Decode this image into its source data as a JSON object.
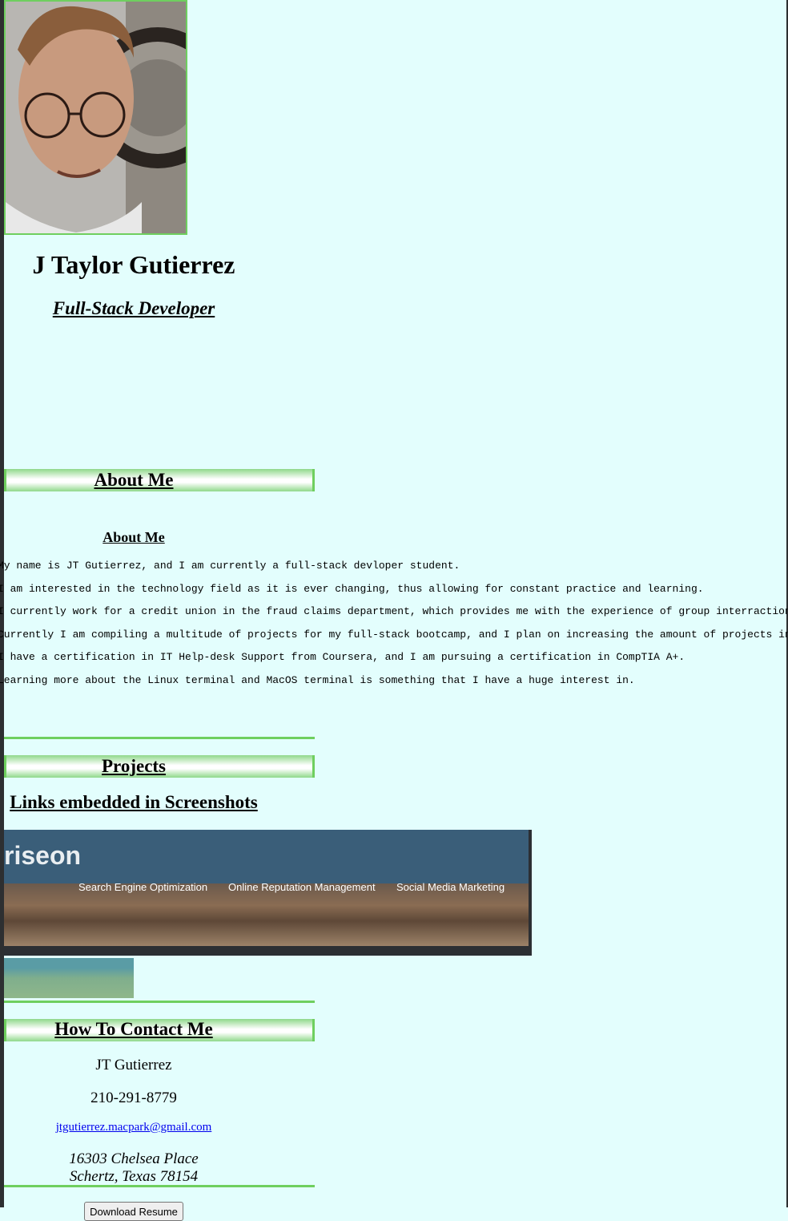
{
  "header": {
    "name": "J Taylor Gutierrez",
    "role": "Full-Stack Developer",
    "photo_icon": "profile-photo"
  },
  "about": {
    "section_title": "About Me",
    "sub_title": "About Me",
    "paragraphs": [
      "My name is JT Gutierrez, and I am currently a full-stack devloper student.",
      "I am interested in the technology field as it is ever changing, thus allowing for constant practice and learning.",
      "I currently work for a credit union in the fraud claims department, which provides me with the experience of group interraction and",
      "Currently I am compiling a multitude of projects for my full-stack bootcamp, and I plan on increasing the amount of projects in my p",
      "I have a certification in IT Help-desk Support from Coursera, and I am pursuing a certification in CompTIA A+.",
      "Learning more about the Linux terminal and MacOS terminal is something that I have a huge interest in."
    ]
  },
  "projects": {
    "section_title": "Projects",
    "sub_title": "Links embedded in Screenshots",
    "screenshot1": {
      "brand": "riseon",
      "nav": [
        "Search Engine Optimization",
        "Online Reputation Management",
        "Social Media Marketing"
      ]
    }
  },
  "contact": {
    "section_title": "How To Contact Me",
    "name": "JT Gutierrez",
    "phone": "210-291-8779",
    "email": "jtgutierrez.macpark@gmail.com",
    "address_line1": "16303 Chelsea Place",
    "address_line2": "Schertz, Texas 78154",
    "resume_button": "Download Resume"
  },
  "colors": {
    "background": "#e3fefd",
    "accent": "#6fcf5f",
    "link": "#0000ee"
  }
}
